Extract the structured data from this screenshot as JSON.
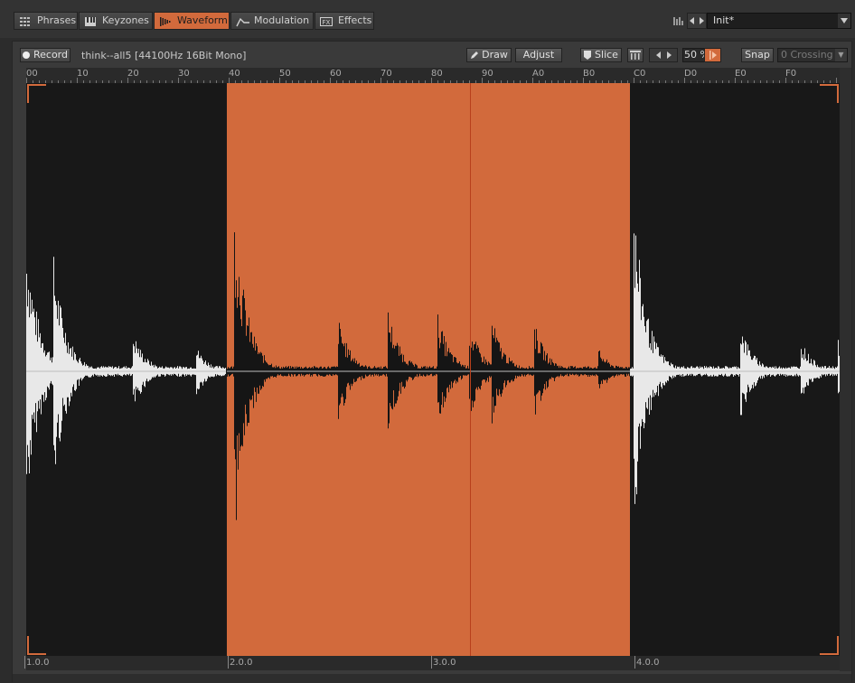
{
  "tabs": [
    {
      "label": "Phrases",
      "icon": "grid-icon",
      "active": false
    },
    {
      "label": "Keyzones",
      "icon": "keyboard-icon",
      "active": false
    },
    {
      "label": "Waveform",
      "icon": "waveform-icon",
      "active": true
    },
    {
      "label": "Modulation",
      "icon": "envelope-icon",
      "active": false
    },
    {
      "label": "Effects",
      "icon": "fx-icon",
      "active": false
    }
  ],
  "preset": {
    "name": "Init*"
  },
  "toolbar": {
    "record_label": "Record",
    "sample_info": "think--all5 [44100Hz 16Bit Mono]",
    "draw_label": "Draw",
    "adjust_label": "Adjust",
    "slice_label": "Slice",
    "zoom_value": "50 %",
    "snap_label": "Snap",
    "snap_mode": "0 Crossing"
  },
  "ruler_top": [
    "00",
    "10",
    "20",
    "30",
    "40",
    "50",
    "60",
    "70",
    "80",
    "90",
    "A0",
    "B0",
    "C0",
    "D0",
    "E0",
    "F0"
  ],
  "ruler_bottom": [
    "1.0.0",
    "2.0.0",
    "3.0.0",
    "4.0.0"
  ],
  "selection": {
    "start_beat": "2.0.0",
    "end_beat": "4.0.0",
    "color": "#d26a3c"
  },
  "colors": {
    "accent": "#d26a3c",
    "waveform": "#e8e8e8",
    "background": "#181818"
  }
}
